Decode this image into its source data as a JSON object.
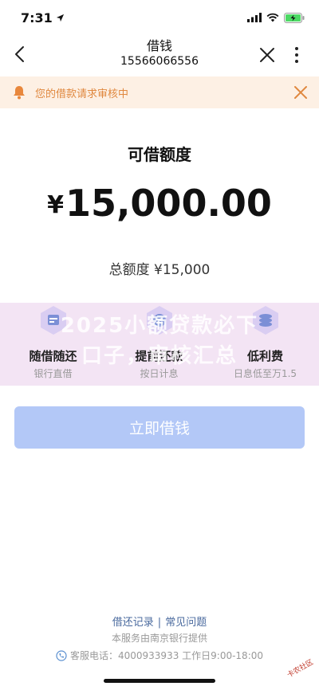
{
  "status_bar": {
    "time": "7:31"
  },
  "nav": {
    "title": "借钱",
    "subtitle": "15566066556"
  },
  "notice": {
    "text": "您的借款请求审核中"
  },
  "credit": {
    "title": "可借额度",
    "currency": "¥",
    "amount": "15,000.00",
    "total_line": "总额度 ¥15,000"
  },
  "features": [
    {
      "title": "随借随还",
      "desc": "银行直借",
      "icon": "calendar-icon"
    },
    {
      "title": "提前还款",
      "desc": "按日计息",
      "icon": "wallet-icon"
    },
    {
      "title": "低利费",
      "desc": "日息低至万1.5",
      "icon": "coins-icon"
    }
  ],
  "watermark": {
    "line1": "2025小额贷款必下",
    "line2": "口子，审核汇总"
  },
  "button": {
    "borrow_label": "立即借钱"
  },
  "footer": {
    "link_records": "借还记录",
    "link_faq": "常见问题",
    "separator": "|",
    "provider": "本服务由南京银行提供",
    "service": "客服电话：4000933933 工作日9:00-18:00"
  },
  "corner_logo": "卡农社区",
  "colors": {
    "notice_bg": "#fdf0e4",
    "notice_text": "#e0883f",
    "button_bg": "#b3c8f7",
    "features_bg": "#f3e4f4",
    "link": "#4a6a9e"
  }
}
